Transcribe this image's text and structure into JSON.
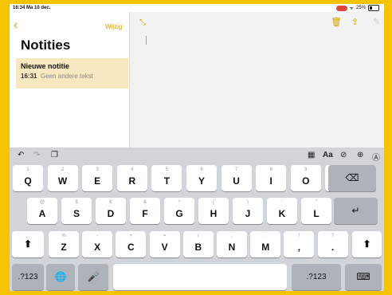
{
  "status": {
    "time": "16:34",
    "date": "Ma 10 dec.",
    "battery": "25%"
  },
  "sidebar": {
    "edit": "Wijzig",
    "title": "Notities",
    "note": {
      "title": "Nieuwe notitie",
      "time": "16:31",
      "preview": "Geen andere tekst"
    }
  },
  "keyboard": {
    "row1": [
      {
        "k": "Q",
        "s": "1"
      },
      {
        "k": "W",
        "s": "2"
      },
      {
        "k": "E",
        "s": "3"
      },
      {
        "k": "R",
        "s": "4"
      },
      {
        "k": "T",
        "s": "5"
      },
      {
        "k": "Y",
        "s": "6"
      },
      {
        "k": "U",
        "s": "7"
      },
      {
        "k": "I",
        "s": "8"
      },
      {
        "k": "O",
        "s": "9"
      },
      {
        "k": "P",
        "s": "0"
      }
    ],
    "row2": [
      {
        "k": "A",
        "s": "@"
      },
      {
        "k": "S",
        "s": "$"
      },
      {
        "k": "D",
        "s": "€"
      },
      {
        "k": "F",
        "s": "&"
      },
      {
        "k": "G",
        "s": "*"
      },
      {
        "k": "H",
        "s": "("
      },
      {
        "k": "J",
        "s": ")"
      },
      {
        "k": "K",
        "s": "'"
      },
      {
        "k": "L",
        "s": "\""
      }
    ],
    "row3": [
      {
        "k": "Z",
        "s": "%"
      },
      {
        "k": "X",
        "s": "-"
      },
      {
        "k": "C",
        "s": "+"
      },
      {
        "k": "V",
        "s": "="
      },
      {
        "k": "B",
        "s": "/"
      },
      {
        "k": "N",
        "s": ";"
      },
      {
        "k": "M",
        "s": ":"
      },
      {
        "k": ",",
        "s": "!"
      },
      {
        "k": ".",
        "s": "?"
      }
    ],
    "numkey": ".?123",
    "icons": {
      "undo": "undo-icon",
      "redo": "redo-icon",
      "paste": "clipboard-icon",
      "table": "table-icon",
      "format": "Aa",
      "check": "checklist-icon",
      "plus": "plus-circle-icon",
      "markup": "markup-icon",
      "delete": "backspace-icon",
      "enter": "return-icon",
      "shift": "shift-icon",
      "globe": "globe-icon",
      "mic": "microphone-icon",
      "hide": "keyboard-hide-icon"
    }
  },
  "colors": {
    "accent": "#d6a400",
    "frame": "#f6c300",
    "selected_note": "#f8e8c2"
  }
}
